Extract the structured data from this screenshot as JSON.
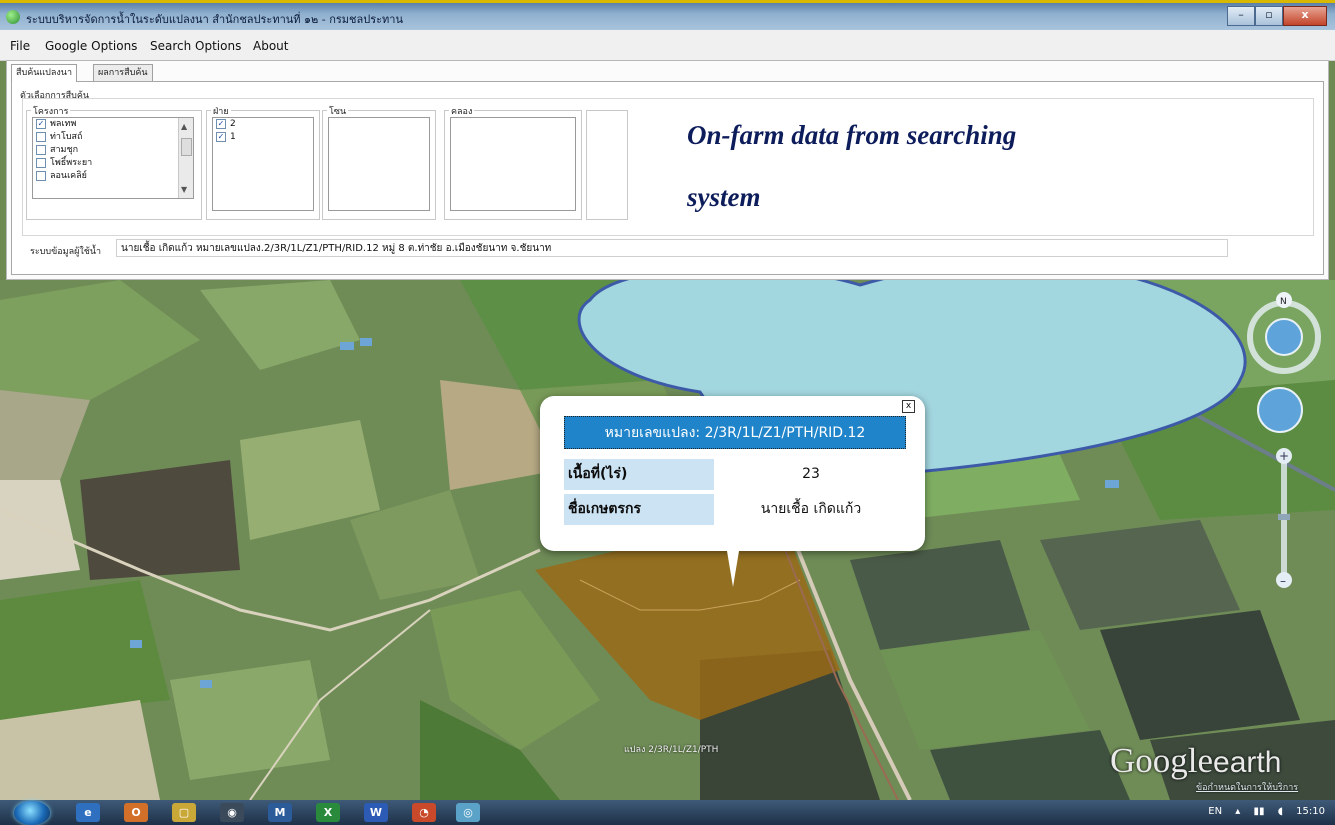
{
  "window": {
    "title": "ระบบบริหารจัดการน้ำในระดับแปลงนา สำนักชลประทานที่ ๑๒ - กรมชลประทาน",
    "controls": {
      "minimize": "–",
      "maximize": "▫",
      "close": "x"
    }
  },
  "menu": {
    "items": [
      "File",
      "Google Options",
      "Search Options",
      "About"
    ]
  },
  "tabs": [
    "สืบค้นแปลงนา",
    "ผลการสืบค้น"
  ],
  "search": {
    "group_label": "ตัวเลือกการสืบค้น",
    "project": {
      "label": "โครงการ",
      "items": [
        {
          "label": "พลเทพ",
          "checked": true
        },
        {
          "label": "ท่าโบสถ์",
          "checked": false
        },
        {
          "label": "สามชุก",
          "checked": false
        },
        {
          "label": "โพธิ์พระยา",
          "checked": false
        },
        {
          "label": "ลอนเคลิย์",
          "checked": false
        }
      ]
    },
    "division": {
      "label": "ฝ่าย",
      "items": [
        {
          "label": "2",
          "checked": true
        },
        {
          "label": "1",
          "checked": true
        }
      ]
    },
    "zone": {
      "label": "โซน"
    },
    "canal": {
      "label": "คลอง"
    },
    "info_label": "ระบบข้อมูลผู้ใช้น้ำ",
    "info_value": "นายเชื้อ เกิดแก้ว หมายเลขแปลง.2/3R/1L/Z1/PTH/RID.12  หมู่ 8 ต.ท่าชัย อ.เมืองชัยนาท จ.ชัยนาท"
  },
  "callout": {
    "line1": "On-farm data from searching",
    "line2": "system"
  },
  "infowindow": {
    "close": "x",
    "title": "หมายเลขแปลง: 2/3R/1L/Z1/PTH/RID.12",
    "rows": [
      {
        "label": "เนื้อที่(ไร่)",
        "value": "23"
      },
      {
        "label": "ชื่อเกษตรกร",
        "value": "นายเชื้อ เกิดแก้ว"
      }
    ]
  },
  "map": {
    "compass_label": "N",
    "zoom_in": "+",
    "zoom_out": "–",
    "parcel_label": "แปลง 2/3R/1L/Z1/PTH",
    "brand_google": "Google",
    "brand_earth": "earth",
    "copyright": "ข้อกำหนดในการให้บริการ"
  },
  "taskbar": {
    "apps": [
      "e",
      "O",
      "▢",
      "◉",
      "M",
      "X",
      "W",
      "◔",
      "◎"
    ],
    "language": "EN",
    "time": "15:10"
  }
}
